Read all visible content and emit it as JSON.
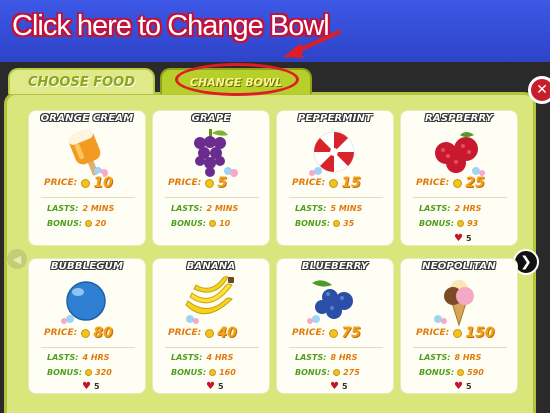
{
  "instruction": "Click here to Change Bowl",
  "tabs": {
    "choose_food": "CHOOSE FOOD",
    "change_bowl": "CHANGE BOWL"
  },
  "labels": {
    "price": "PRICE:",
    "lasts": "LASTS:",
    "bonus": "BONUS:"
  },
  "colors": {
    "banner": "#3b4fd8",
    "panel": "#d8e67c",
    "card": "#fffef4",
    "highlight": "#e01c24"
  },
  "foods": [
    {
      "name": "ORANGE CREAM",
      "price": "10",
      "lasts": "2 MINS",
      "bonus": "20",
      "hearts": "",
      "icon": "orange-cream-popsicle-icon"
    },
    {
      "name": "GRAPE",
      "price": "5",
      "lasts": "2 MINS",
      "bonus": "10",
      "hearts": "",
      "icon": "grape-icon"
    },
    {
      "name": "PEPPERMINT",
      "price": "15",
      "lasts": "5 MINS",
      "bonus": "35",
      "hearts": "",
      "icon": "peppermint-candy-icon"
    },
    {
      "name": "RASPBERRY",
      "price": "25",
      "lasts": "2 HRS",
      "bonus": "93",
      "hearts": "5",
      "icon": "raspberry-icon"
    },
    {
      "name": "BUBBLEGUM",
      "price": "80",
      "lasts": "4 HRS",
      "bonus": "320",
      "hearts": "5",
      "icon": "bubblegum-ball-icon"
    },
    {
      "name": "BANANA",
      "price": "40",
      "lasts": "4 HRS",
      "bonus": "160",
      "hearts": "5",
      "icon": "banana-icon"
    },
    {
      "name": "BLUEBERRY",
      "price": "75",
      "lasts": "8 HRS",
      "bonus": "275",
      "hearts": "5",
      "icon": "blueberry-icon"
    },
    {
      "name": "NEOPOLITAN",
      "price": "150",
      "lasts": "8 HRS",
      "bonus": "590",
      "hearts": "5",
      "icon": "neopolitan-ice-cream-icon"
    }
  ]
}
